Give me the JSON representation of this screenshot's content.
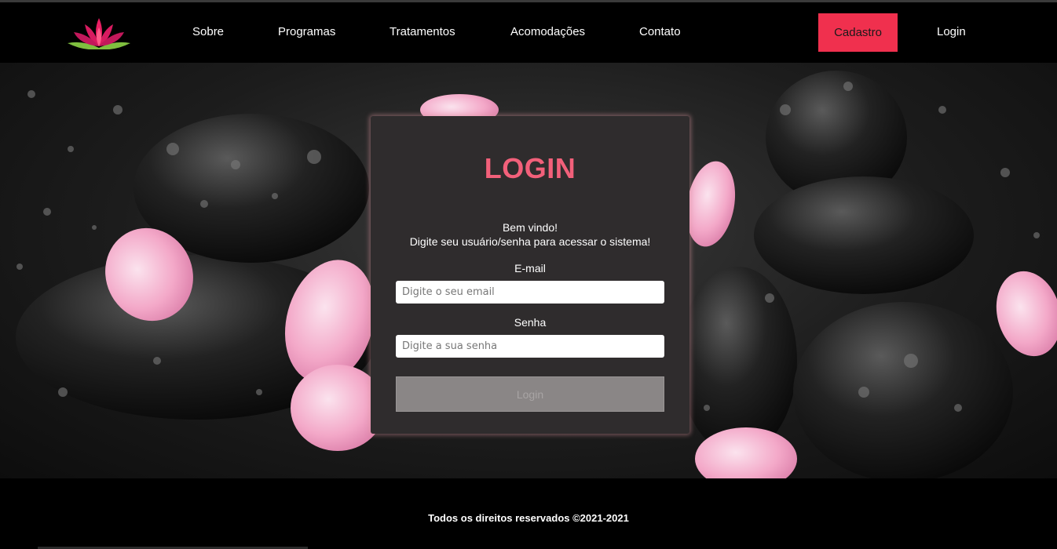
{
  "header": {
    "logo_icon": "lotus-icon",
    "nav": [
      {
        "label": "Sobre"
      },
      {
        "label": "Programas"
      },
      {
        "label": "Tratamentos"
      },
      {
        "label": "Acomodações"
      },
      {
        "label": "Contato"
      }
    ],
    "cadastro_label": "Cadastro",
    "login_label": "Login"
  },
  "login_panel": {
    "title": "LOGIN",
    "welcome_line1": "Bem vindo!",
    "welcome_line2": "Digite seu usuário/senha para acessar o sistema!",
    "email_label": "E-mail",
    "email_placeholder": "Digite o seu email",
    "password_label": "Senha",
    "password_placeholder": "Digite a sua senha",
    "submit_label": "Login"
  },
  "footer": {
    "text": "Todos os direitos reservados ©2021-2021"
  },
  "colors": {
    "accent": "#f0304e",
    "title": "#f2607a",
    "panel_bg": "#2f2c2d",
    "button_disabled": "#8a8686"
  }
}
